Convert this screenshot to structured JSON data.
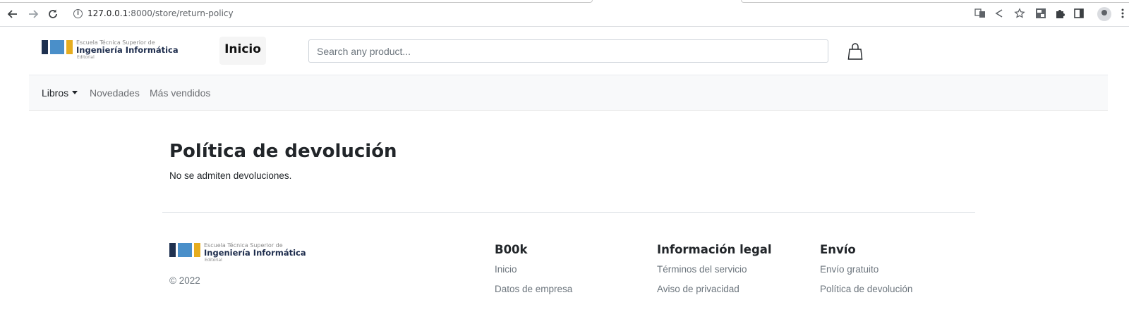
{
  "browser": {
    "url_host": "127.0.0.1",
    "url_rest": ":8000/store/return-policy",
    "nav_icons": [
      "back-arrow-icon",
      "forward-arrow-icon",
      "reload-icon",
      "info-icon"
    ],
    "toolbar_icons": [
      "translate-icon",
      "share-icon",
      "bookmark-star-icon",
      "extension-se-icon",
      "puzzle-icon",
      "side-panel-icon",
      "profile-icon",
      "menu-dots-icon"
    ]
  },
  "header": {
    "logo": {
      "line1": "Escuela Técnica Superior de",
      "line2": "Ingeniería Informática",
      "line3": "Editorial"
    },
    "home_label": "Inicio",
    "search_placeholder": "Search any product...",
    "cart_icon": "shopping-bag-icon"
  },
  "navbar": {
    "items": [
      {
        "label": "Libros",
        "dropdown": true,
        "active": true
      },
      {
        "label": "Novedades",
        "dropdown": false,
        "active": false
      },
      {
        "label": "Más vendidos",
        "dropdown": false,
        "active": false
      }
    ]
  },
  "main": {
    "title": "Política de devolución",
    "text": "No se admiten devoluciones."
  },
  "footer": {
    "logo": {
      "line1": "Escuela Técnica Superior de",
      "line2": "Ingeniería Informática",
      "line3": "Editorial"
    },
    "copyright": "© 2022",
    "columns": [
      {
        "heading": "B00k",
        "links": [
          "Inicio",
          "Datos de empresa"
        ]
      },
      {
        "heading": "Información legal",
        "links": [
          "Términos del servicio",
          "Aviso de privacidad"
        ]
      },
      {
        "heading": "Envío",
        "links": [
          "Envío gratuito",
          "Política de devolución"
        ]
      }
    ]
  },
  "colors": {
    "logo_dark": "#1f3150",
    "logo_blue": "#4a8fc9",
    "logo_yellow": "#e6ad1f",
    "navbar_bg": "#f8f9fa",
    "muted_text": "#6c757d"
  }
}
